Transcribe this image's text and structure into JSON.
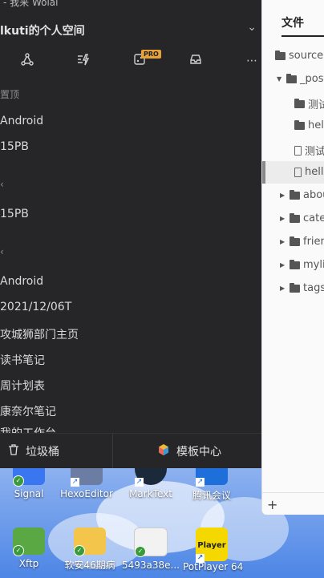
{
  "window_title": "- 我来 Wolai",
  "space": {
    "name": "lkuti的个人空间"
  },
  "toolbar": {
    "pro_badge": "PRO",
    "icons": [
      "share-icon",
      "flash-icon",
      "dice-icon",
      "inbox-icon",
      "more-icon"
    ]
  },
  "sidebar": {
    "pinned_header": "置顶",
    "items": [
      {
        "label": "Android"
      },
      {
        "label": "15PB"
      },
      {
        "label": "15PB"
      },
      {
        "label": "Android"
      },
      {
        "label": "2021/12/06T"
      },
      {
        "label": "攻城狮部门主页"
      },
      {
        "label": "读书笔记"
      },
      {
        "label": "周计划表"
      },
      {
        "label": "康奈尔笔记"
      },
      {
        "label": "我的工作台"
      }
    ],
    "section_mark_1": "‹",
    "section_mark_2": "‹"
  },
  "bottom": {
    "trash_label": "垃圾桶",
    "templates_label": "模板中心"
  },
  "file_panel": {
    "tab_label": "文件",
    "items": [
      {
        "label": "source"
      },
      {
        "label": "_post"
      },
      {
        "label": "测试"
      },
      {
        "label": "hell"
      },
      {
        "label": "测试"
      },
      {
        "label": "hell"
      },
      {
        "label": "abou"
      },
      {
        "label": "categ"
      },
      {
        "label": "frien"
      },
      {
        "label": "mylis"
      },
      {
        "label": "tags"
      }
    ],
    "add_label": "+"
  },
  "desktop": {
    "icons": [
      {
        "label": "Signal"
      },
      {
        "label": "HexoEditor"
      },
      {
        "label": "MarkText"
      },
      {
        "label": "腾讯会议"
      },
      {
        "label": "Xftp"
      },
      {
        "label": "软安46期病"
      },
      {
        "label": "5493a38e..."
      },
      {
        "label": "PotPlayer 64"
      }
    ],
    "potplayer_text": "Player"
  },
  "colors": {
    "panel_dark": "#262628",
    "file_panel": "#fafafa",
    "pro": "#e8a23a",
    "desktop_blue": "#3b6ed8"
  }
}
